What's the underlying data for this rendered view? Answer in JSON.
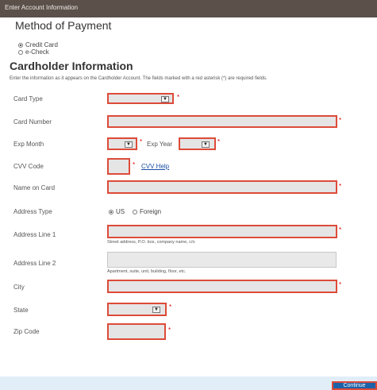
{
  "header": {
    "title": "Enter Account Information"
  },
  "payment": {
    "title": "Method of Payment",
    "options": [
      {
        "label": "Credit Card",
        "selected": true
      },
      {
        "label": "e-Check",
        "selected": false
      }
    ]
  },
  "cardholder": {
    "title": "Cardholder Information",
    "instructions": "Enter the information as it appears on the Cardholder Account. The fields marked with a red asterisk (*) are required fields."
  },
  "form": {
    "required_marker": "*",
    "card_type_label": "Card Type",
    "card_number_label": "Card Number",
    "exp_month_label": "Exp Month",
    "exp_year_label": "Exp Year",
    "cvv_label": "CVV Code",
    "cvv_help": "CVV Help",
    "name_label": "Name on Card",
    "address_type_label": "Address Type",
    "address_type_options": [
      {
        "label": "US",
        "selected": true
      },
      {
        "label": "Foreign",
        "selected": false
      }
    ],
    "address1_label": "Address Line 1",
    "address1_hint": "Street address, P.O. box, company name, c/o",
    "address2_label": "Address Line 2",
    "address2_hint": "Apartment, suite, unit, building, floor, etc.",
    "city_label": "City",
    "state_label": "State",
    "zip_label": "Zip Code"
  },
  "footer": {
    "continue_label": "Continue"
  },
  "colors": {
    "required_outline": "#dd4b39",
    "header_bg": "#5b504a",
    "footer_bg": "#e1eef8",
    "button_bg": "#1c62a8"
  },
  "icons": {
    "dropdown": "chevron-down-icon"
  }
}
